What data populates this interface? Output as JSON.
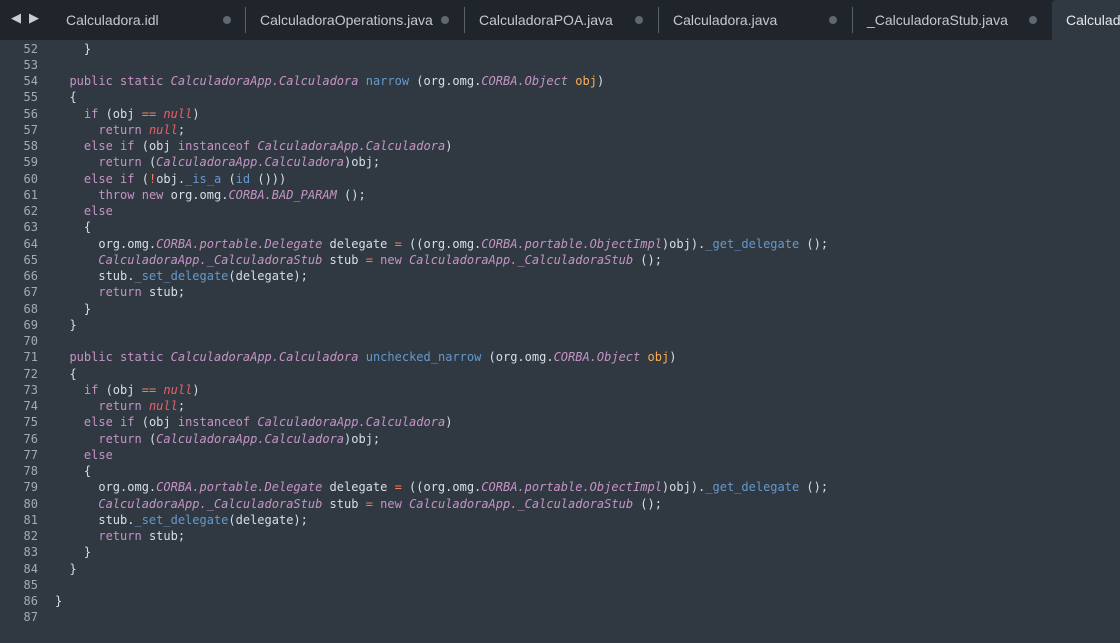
{
  "tabbar": {
    "back_icon": "arrow-left-icon",
    "forward_icon": "arrow-right-icon",
    "tabs": [
      {
        "label": "Calculadora.idl",
        "active": false
      },
      {
        "label": "CalculadoraOperations.java",
        "active": false
      },
      {
        "label": "CalculadoraPOA.java",
        "active": false
      },
      {
        "label": "Calculadora.java",
        "active": false
      },
      {
        "label": "_CalculadoraStub.java",
        "active": false
      },
      {
        "label": "CalculadoraHelper.java",
        "active": true
      }
    ]
  },
  "colors": {
    "background": "#303841",
    "tabbar": "#1f252b",
    "keyword": "#c594c5",
    "function": "#6699cc",
    "parameter": "#f9ae58",
    "null": "#ec5f66",
    "operator": "#f97b58",
    "text": "#d8dee9",
    "line_number": "#a4abb3"
  },
  "editor": {
    "lines": [
      {
        "n": "52",
        "tokens": [
          [
            "    ",
            "plain"
          ],
          [
            "}",
            "bracket"
          ]
        ]
      },
      {
        "n": "53",
        "tokens": []
      },
      {
        "n": "54",
        "tokens": [
          [
            "  ",
            "plain"
          ],
          [
            "public",
            "keyword"
          ],
          [
            " ",
            "plain"
          ],
          [
            "static",
            "keyword"
          ],
          [
            " ",
            "plain"
          ],
          [
            "CalculadoraApp.Calculadora",
            "type"
          ],
          [
            " ",
            "plain"
          ],
          [
            "narrow",
            "func"
          ],
          [
            " (org.omg.",
            "plain"
          ],
          [
            "CORBA.Object",
            "type"
          ],
          [
            " ",
            "plain"
          ],
          [
            "obj",
            "param"
          ],
          [
            ")",
            "plain"
          ]
        ]
      },
      {
        "n": "55",
        "tokens": [
          [
            "  {",
            "plain"
          ]
        ]
      },
      {
        "n": "56",
        "tokens": [
          [
            "    ",
            "plain"
          ],
          [
            "if",
            "keyword"
          ],
          [
            " (obj ",
            "plain"
          ],
          [
            "==",
            "op"
          ],
          [
            " ",
            "plain"
          ],
          [
            "null",
            "null"
          ],
          [
            ")",
            "plain"
          ]
        ]
      },
      {
        "n": "57",
        "tokens": [
          [
            "      ",
            "plain"
          ],
          [
            "return",
            "keyword"
          ],
          [
            " ",
            "plain"
          ],
          [
            "null",
            "null"
          ],
          [
            ";",
            "plain"
          ]
        ]
      },
      {
        "n": "58",
        "tokens": [
          [
            "    ",
            "plain"
          ],
          [
            "else",
            "keyword"
          ],
          [
            " ",
            "plain"
          ],
          [
            "if",
            "keyword"
          ],
          [
            " (obj ",
            "plain"
          ],
          [
            "instanceof",
            "keyword"
          ],
          [
            " ",
            "plain"
          ],
          [
            "CalculadoraApp.Calculadora",
            "type"
          ],
          [
            ")",
            "plain"
          ]
        ]
      },
      {
        "n": "59",
        "tokens": [
          [
            "      ",
            "plain"
          ],
          [
            "return",
            "keyword"
          ],
          [
            " (",
            "plain"
          ],
          [
            "CalculadoraApp.Calculadora",
            "type"
          ],
          [
            ")obj;",
            "plain"
          ]
        ]
      },
      {
        "n": "60",
        "tokens": [
          [
            "    ",
            "plain"
          ],
          [
            "else",
            "keyword"
          ],
          [
            " ",
            "plain"
          ],
          [
            "if",
            "keyword"
          ],
          [
            " (",
            "plain"
          ],
          [
            "!",
            "op"
          ],
          [
            "obj.",
            "plain"
          ],
          [
            "_is_a",
            "func"
          ],
          [
            " (",
            "plain"
          ],
          [
            "id",
            "func"
          ],
          [
            " ()))",
            "plain"
          ]
        ]
      },
      {
        "n": "61",
        "tokens": [
          [
            "      ",
            "plain"
          ],
          [
            "throw",
            "keyword"
          ],
          [
            " ",
            "plain"
          ],
          [
            "new",
            "keyword"
          ],
          [
            " org.omg.",
            "plain"
          ],
          [
            "CORBA.BAD_PARAM",
            "type"
          ],
          [
            " ();",
            "plain"
          ]
        ]
      },
      {
        "n": "62",
        "tokens": [
          [
            "    ",
            "plain"
          ],
          [
            "else",
            "keyword"
          ]
        ]
      },
      {
        "n": "63",
        "tokens": [
          [
            "    {",
            "plain"
          ]
        ]
      },
      {
        "n": "64",
        "tokens": [
          [
            "      org.omg.",
            "plain"
          ],
          [
            "CORBA.portable.Delegate",
            "type"
          ],
          [
            " delegate ",
            "plain"
          ],
          [
            "=",
            "op"
          ],
          [
            " ((org.omg.",
            "plain"
          ],
          [
            "CORBA.portable.ObjectImpl",
            "type"
          ],
          [
            ")obj).",
            "plain"
          ],
          [
            "_get_delegate",
            "func"
          ],
          [
            " ();",
            "plain"
          ]
        ]
      },
      {
        "n": "65",
        "tokens": [
          [
            "      ",
            "plain"
          ],
          [
            "CalculadoraApp._CalculadoraStub",
            "type"
          ],
          [
            " stub ",
            "plain"
          ],
          [
            "=",
            "op"
          ],
          [
            " ",
            "plain"
          ],
          [
            "new",
            "keyword"
          ],
          [
            " ",
            "plain"
          ],
          [
            "CalculadoraApp._CalculadoraStub",
            "type"
          ],
          [
            " ();",
            "plain"
          ]
        ]
      },
      {
        "n": "66",
        "tokens": [
          [
            "      stub.",
            "plain"
          ],
          [
            "_set_delegate",
            "func"
          ],
          [
            "(delegate);",
            "plain"
          ]
        ]
      },
      {
        "n": "67",
        "tokens": [
          [
            "      ",
            "plain"
          ],
          [
            "return",
            "keyword"
          ],
          [
            " stub;",
            "plain"
          ]
        ]
      },
      {
        "n": "68",
        "tokens": [
          [
            "    }",
            "plain"
          ]
        ]
      },
      {
        "n": "69",
        "tokens": [
          [
            "  }",
            "plain"
          ]
        ]
      },
      {
        "n": "70",
        "tokens": []
      },
      {
        "n": "71",
        "tokens": [
          [
            "  ",
            "plain"
          ],
          [
            "public",
            "keyword"
          ],
          [
            " ",
            "plain"
          ],
          [
            "static",
            "keyword"
          ],
          [
            " ",
            "plain"
          ],
          [
            "CalculadoraApp.Calculadora",
            "type"
          ],
          [
            " ",
            "plain"
          ],
          [
            "unchecked_narrow",
            "func"
          ],
          [
            " (org.omg.",
            "plain"
          ],
          [
            "CORBA.Object",
            "type"
          ],
          [
            " ",
            "plain"
          ],
          [
            "obj",
            "param"
          ],
          [
            ")",
            "plain"
          ]
        ]
      },
      {
        "n": "72",
        "tokens": [
          [
            "  {",
            "plain"
          ]
        ]
      },
      {
        "n": "73",
        "tokens": [
          [
            "    ",
            "plain"
          ],
          [
            "if",
            "keyword"
          ],
          [
            " (obj ",
            "plain"
          ],
          [
            "==",
            "op"
          ],
          [
            " ",
            "plain"
          ],
          [
            "null",
            "null"
          ],
          [
            ")",
            "plain"
          ]
        ]
      },
      {
        "n": "74",
        "tokens": [
          [
            "      ",
            "plain"
          ],
          [
            "return",
            "keyword"
          ],
          [
            " ",
            "plain"
          ],
          [
            "null",
            "null"
          ],
          [
            ";",
            "plain"
          ]
        ]
      },
      {
        "n": "75",
        "tokens": [
          [
            "    ",
            "plain"
          ],
          [
            "else",
            "keyword"
          ],
          [
            " ",
            "plain"
          ],
          [
            "if",
            "keyword"
          ],
          [
            " (obj ",
            "plain"
          ],
          [
            "instanceof",
            "keyword"
          ],
          [
            " ",
            "plain"
          ],
          [
            "CalculadoraApp.Calculadora",
            "type"
          ],
          [
            ")",
            "plain"
          ]
        ]
      },
      {
        "n": "76",
        "tokens": [
          [
            "      ",
            "plain"
          ],
          [
            "return",
            "keyword"
          ],
          [
            " (",
            "plain"
          ],
          [
            "CalculadoraApp.Calculadora",
            "type"
          ],
          [
            ")obj;",
            "plain"
          ]
        ]
      },
      {
        "n": "77",
        "tokens": [
          [
            "    ",
            "plain"
          ],
          [
            "else",
            "keyword"
          ]
        ]
      },
      {
        "n": "78",
        "tokens": [
          [
            "    {",
            "plain"
          ]
        ]
      },
      {
        "n": "79",
        "tokens": [
          [
            "      org.omg.",
            "plain"
          ],
          [
            "CORBA.portable.Delegate",
            "type"
          ],
          [
            " delegate ",
            "plain"
          ],
          [
            "=",
            "op"
          ],
          [
            " ((org.omg.",
            "plain"
          ],
          [
            "CORBA.portable.ObjectImpl",
            "type"
          ],
          [
            ")obj).",
            "plain"
          ],
          [
            "_get_delegate",
            "func"
          ],
          [
            " ();",
            "plain"
          ]
        ]
      },
      {
        "n": "80",
        "tokens": [
          [
            "      ",
            "plain"
          ],
          [
            "CalculadoraApp._CalculadoraStub",
            "type"
          ],
          [
            " stub ",
            "plain"
          ],
          [
            "=",
            "op"
          ],
          [
            " ",
            "plain"
          ],
          [
            "new",
            "keyword"
          ],
          [
            " ",
            "plain"
          ],
          [
            "CalculadoraApp._CalculadoraStub",
            "type"
          ],
          [
            " ();",
            "plain"
          ]
        ]
      },
      {
        "n": "81",
        "tokens": [
          [
            "      stub.",
            "plain"
          ],
          [
            "_set_delegate",
            "func"
          ],
          [
            "(delegate);",
            "plain"
          ]
        ]
      },
      {
        "n": "82",
        "tokens": [
          [
            "      ",
            "plain"
          ],
          [
            "return",
            "keyword"
          ],
          [
            " stub;",
            "plain"
          ]
        ]
      },
      {
        "n": "83",
        "tokens": [
          [
            "    }",
            "plain"
          ]
        ]
      },
      {
        "n": "84",
        "tokens": [
          [
            "  }",
            "plain"
          ]
        ]
      },
      {
        "n": "85",
        "tokens": []
      },
      {
        "n": "86",
        "tokens": [
          [
            "}",
            "plain"
          ]
        ]
      },
      {
        "n": "87",
        "tokens": []
      }
    ]
  }
}
